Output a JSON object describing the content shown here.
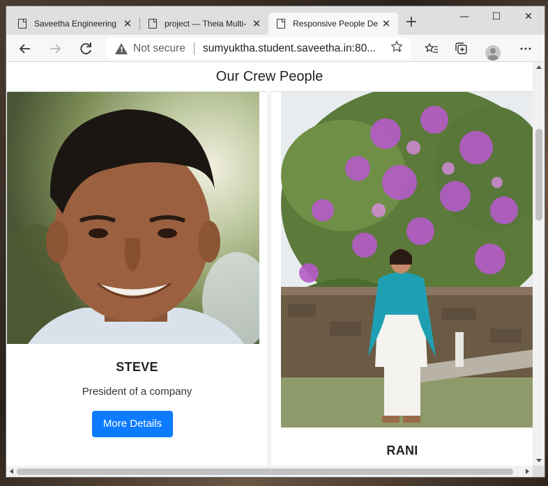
{
  "browser": {
    "tabs": [
      {
        "title": "Saveetha Engineering",
        "active": false
      },
      {
        "title": "project — Theia Multi-",
        "active": false
      },
      {
        "title": "Responsive People De",
        "active": true
      }
    ],
    "new_tab_glyph": "+",
    "window_controls": {
      "minimize": "—",
      "maximize": "☐",
      "close": "✕"
    },
    "address": {
      "security_label": "Not secure",
      "url": "sumyuktha.student.saveetha.in:80..."
    },
    "icons": [
      "back-icon",
      "forward-icon",
      "refresh-icon",
      "warning-icon",
      "add-favorite-icon",
      "favorites-icon",
      "collections-icon",
      "profile-icon",
      "more-icon"
    ]
  },
  "page": {
    "title": "Our Crew People",
    "people": [
      {
        "name": "STEVE",
        "role": "President of a company",
        "button_label": "More Details"
      },
      {
        "name": "RANI"
      }
    ]
  },
  "colors": {
    "primary_button": "#0d7bff",
    "tabstrip": "#dfdfdf",
    "toolbar": "#f7f7f7"
  }
}
